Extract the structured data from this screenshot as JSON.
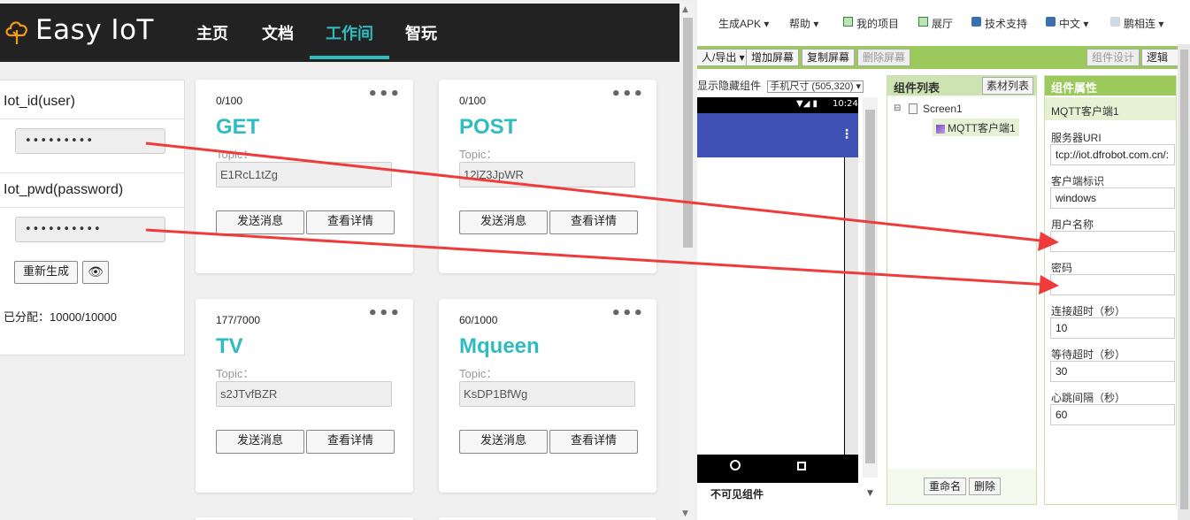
{
  "easyiot": {
    "brand": "Easy IoT",
    "nav": [
      "主页",
      "文档",
      "工作间",
      "智玩"
    ],
    "active_nav": "工作间",
    "accent": "#2fbcc0",
    "credentials": {
      "iot_id_label": "Iot_id(user)",
      "iot_id_value": "•••••••••",
      "iot_pwd_label": "Iot_pwd(password)",
      "iot_pwd_value": "••••••••••",
      "regen_label": "重新生成",
      "eye_icon": "eye-icon",
      "allocated_label": "已分配：",
      "allocated_value": "10000/10000"
    },
    "cards": [
      {
        "count": "0/100",
        "title": "GET",
        "topic_label": "Topic：",
        "topic": "E1RcL1tZg",
        "send": "发送消息",
        "detail": "查看详情"
      },
      {
        "count": "0/100",
        "title": "POST",
        "topic_label": "Topic：",
        "topic": "12lZ3JpWR",
        "send": "发送消息",
        "detail": "查看详情"
      },
      {
        "count": "177/7000",
        "title": "TV",
        "topic_label": "Topic：",
        "topic": "s2JTvfBZR",
        "send": "发送消息",
        "detail": "查看详情"
      },
      {
        "count": "60/1000",
        "title": "Mqueen",
        "topic_label": "Topic：",
        "topic": "KsDP1BfWg",
        "send": "发送消息",
        "detail": "查看详情"
      }
    ],
    "card_menu_icon": "more-dots-icon"
  },
  "appinventor": {
    "top_menu": [
      "生成APK ▾",
      "帮助 ▾",
      "我的项目",
      "展厅",
      "技术支持",
      "中文 ▾",
      "鹏相连 ▾"
    ],
    "toolbar": {
      "import_export": "人/导出 ▾",
      "add_screen": "增加屏幕",
      "copy_screen": "复制屏幕",
      "delete_screen": "删除屏幕",
      "designer": "组件设计",
      "blocks": "逻辑设"
    },
    "viewer": {
      "show_hidden": "显示隐藏组件",
      "size_select": "手机尺寸 (505,320) ▾",
      "status_time": "10:24",
      "invisible_label": "不可见组件"
    },
    "components": {
      "title": "组件列表",
      "assets_btn": "素材列表",
      "screen": "Screen1",
      "mqtt": "MQTT客户端1",
      "rename": "重命名",
      "delete": "删除"
    },
    "properties": {
      "title": "组件属性",
      "component": "MQTT客户端1",
      "fields": [
        {
          "label": "服务器URI",
          "value": "tcp://iot.dfrobot.com.cn/:"
        },
        {
          "label": "客户端标识",
          "value": "windows"
        },
        {
          "label": "用户名称",
          "value": ""
        },
        {
          "label": "密码",
          "value": ""
        },
        {
          "label": "连接超时（秒）",
          "value": "10"
        },
        {
          "label": "等待超时（秒）",
          "value": "30"
        },
        {
          "label": "心跳间隔（秒）",
          "value": "60"
        }
      ]
    },
    "accent_green": "#9bc95c",
    "arrow_color": "#ef3b3b"
  }
}
